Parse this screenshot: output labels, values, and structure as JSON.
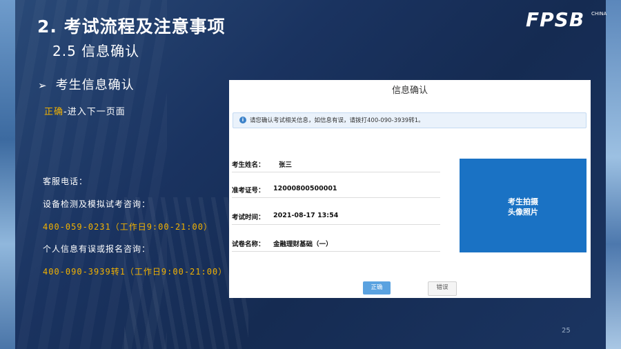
{
  "slide": {
    "title": "2. 考试流程及注意事项",
    "subtitle": "2.5 信息确认",
    "logo": "FPSB",
    "logo_sub": "CHINA",
    "bullet": "考生信息确认",
    "instruction_highlight": "正确",
    "instruction_rest": "-进入下一页面",
    "service_label": "客服电话：",
    "device_label": "设备检测及模拟试考咨询：",
    "device_phone": "400-059-0231（工作日9:00-21:00）",
    "personal_label": "个人信息有误或报名咨询：",
    "personal_phone": "400-090-3939转1（工作日9:00-21:00）",
    "page_number": "25"
  },
  "screen": {
    "title": "信息确认",
    "notice": "请您确认考试相关信息，如信息有误，请拨打400-090-3939转1。",
    "fields": [
      {
        "label": "考生姓名：",
        "value": "张三"
      },
      {
        "label": "准考证号：",
        "value": "12000800500001"
      },
      {
        "label": "考试时间：",
        "value": "2021-08-17 13:54"
      },
      {
        "label": "试卷名称：",
        "value": "金融理财基础（一）"
      }
    ],
    "photo_line1": "考生拍摄",
    "photo_line2": "头像照片",
    "confirm_button": "正确",
    "error_button": "错误"
  },
  "colors": {
    "highlight": "#f2b200",
    "photo_box": "#1a72c4",
    "confirm_button": "#5aa2e0"
  },
  "icons": {
    "bullet": "arrow-right-icon",
    "notice": "info-icon"
  }
}
